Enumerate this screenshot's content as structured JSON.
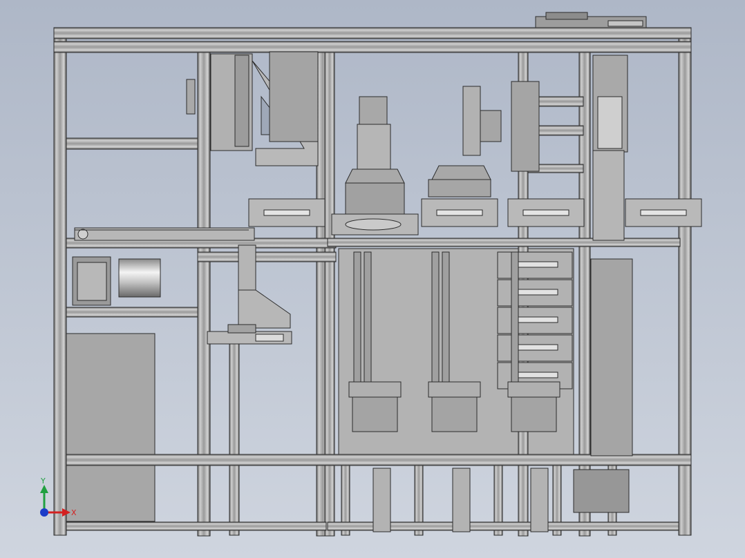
{
  "view": {
    "background_top": "#aeb7c7",
    "background_bottom": "#cdd4df",
    "frame_color": "#a8a8a8",
    "frame_shadow": "#5c5c5c",
    "plate_color": "#b4b4b4",
    "dark_line": "#2b2b2b"
  },
  "triad": {
    "x_label": "X",
    "y_label": "Y",
    "x_color": "#d42020",
    "y_color": "#20a040",
    "z_color": "#1c3cc8"
  }
}
